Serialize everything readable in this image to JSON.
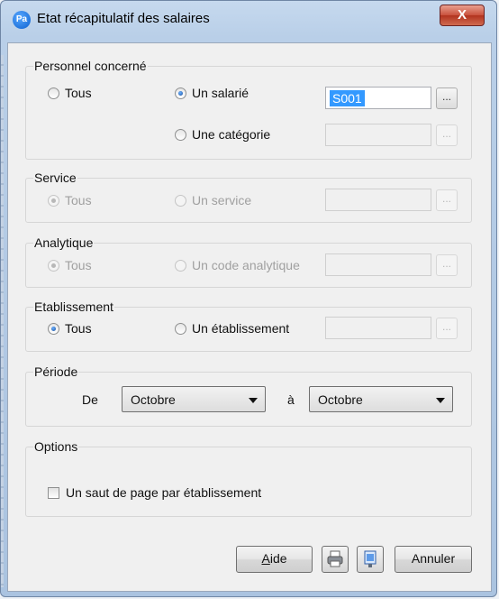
{
  "window": {
    "app_badge": "Pa",
    "title": "Etat récapitulatif des salaires",
    "close_glyph": "X"
  },
  "groups": {
    "personnel": {
      "legend": "Personnel concerné",
      "opt_tous": "Tous",
      "opt_salarie": "Un salarié",
      "opt_categorie": "Une catégorie",
      "salarie_value": "S001",
      "selected": "salarie"
    },
    "service": {
      "legend": "Service",
      "opt_tous": "Tous",
      "opt_service": "Un service",
      "selected": "tous",
      "disabled": true
    },
    "analytique": {
      "legend": "Analytique",
      "opt_tous": "Tous",
      "opt_code": "Un code analytique",
      "selected": "tous",
      "disabled": true
    },
    "etablissement": {
      "legend": "Etablissement",
      "opt_tous": "Tous",
      "opt_etab": "Un établissement",
      "selected": "tous"
    },
    "periode": {
      "legend": "Période",
      "de_label": "De",
      "a_label": "à",
      "de_value": "Octobre",
      "a_value": "Octobre"
    },
    "options": {
      "legend": "Options",
      "saut_label": "Un saut de page par établissement",
      "saut_checked": false
    }
  },
  "ellipsis_label": "...",
  "footer": {
    "aide_mnemonic": "A",
    "aide_rest": "ide",
    "annuler_label": "Annuler",
    "print_icon": "printer-icon",
    "preview_icon": "preview-icon"
  }
}
